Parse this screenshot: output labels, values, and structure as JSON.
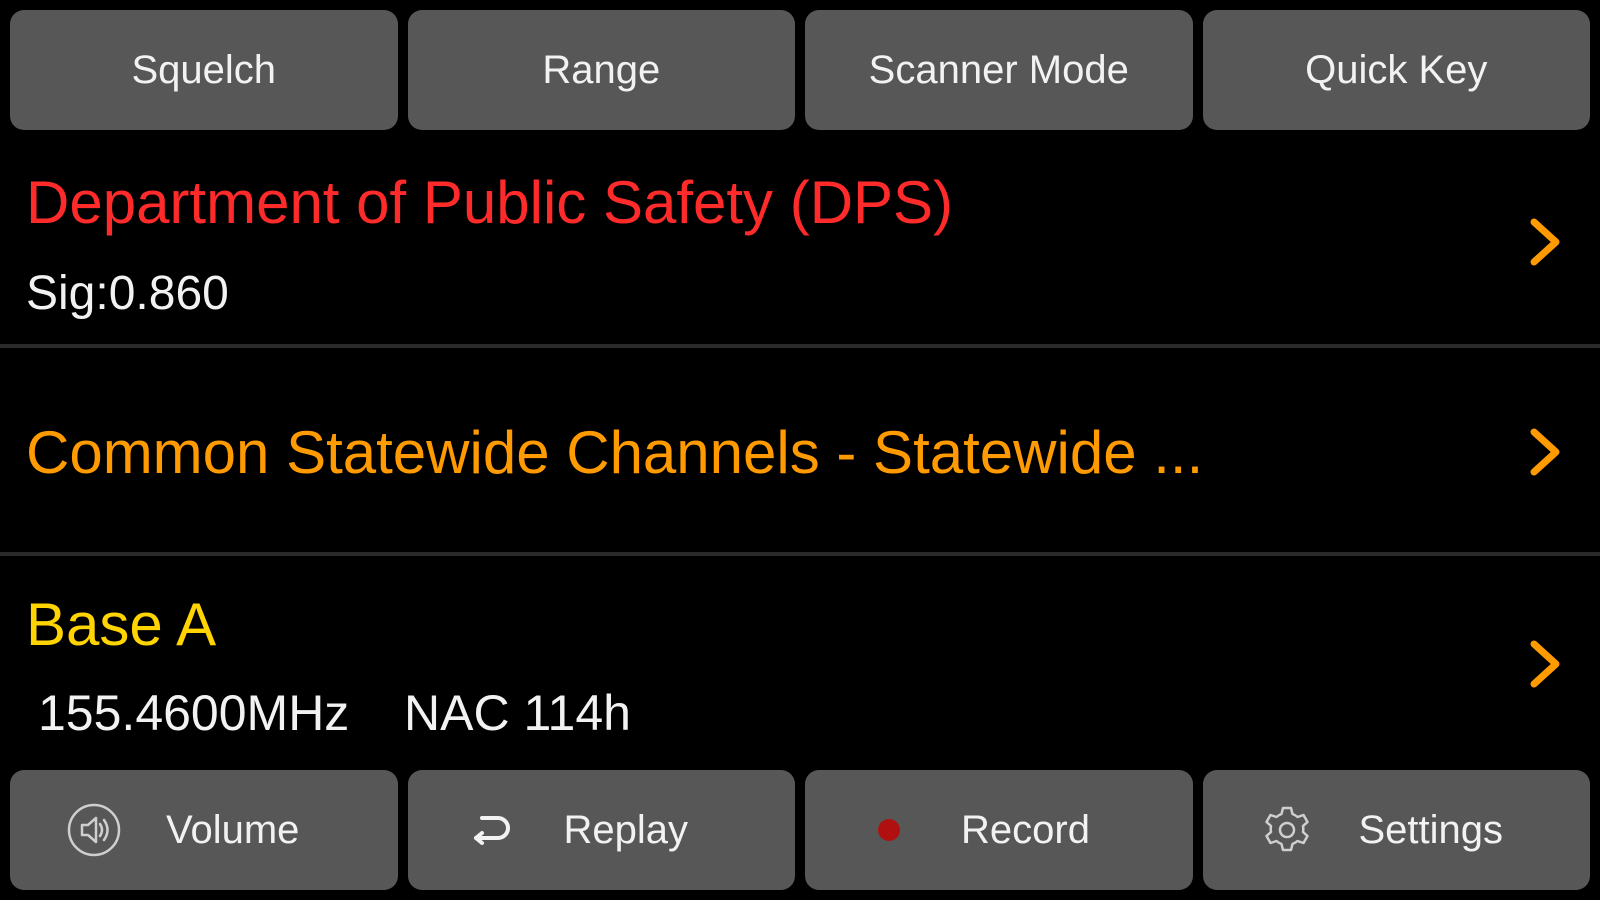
{
  "top_buttons": {
    "squelch": "Squelch",
    "range": "Range",
    "scanner_mode": "Scanner Mode",
    "quick_key": "Quick Key"
  },
  "rows": {
    "system": {
      "title": "Department of Public Safety (DPS)",
      "signal": "Sig:0.860",
      "color": "#ff2b2b"
    },
    "department": {
      "title": "Common Statewide Channels - Statewide ...",
      "color": "#ff9a00"
    },
    "channel": {
      "title": "Base A",
      "frequency": "155.4600MHz",
      "nac": "NAC 114h",
      "color": "#ffd400"
    }
  },
  "bottom_buttons": {
    "volume": {
      "label": "Volume",
      "icon": "speaker-icon"
    },
    "replay": {
      "label": "Replay",
      "icon": "replay-icon"
    },
    "record": {
      "label": "Record",
      "icon": "record-dot-icon"
    },
    "settings": {
      "label": "Settings",
      "icon": "gear-icon"
    }
  },
  "colors": {
    "background": "#000000",
    "button": "#575757",
    "chevron": "#ff9a00",
    "record_dot": "#b01010"
  }
}
